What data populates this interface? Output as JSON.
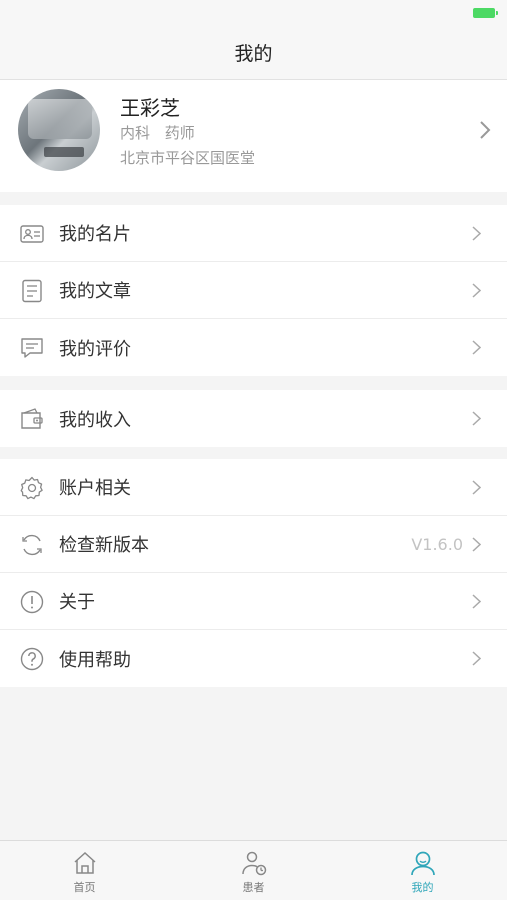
{
  "nav": {
    "title": "我的"
  },
  "profile": {
    "name": "王彩芝",
    "department": "内科",
    "role": "药师",
    "hospital": "北京市平谷区国医堂"
  },
  "groups": [
    {
      "items": [
        {
          "label": "我的名片",
          "icon": "id-card-icon"
        },
        {
          "label": "我的文章",
          "icon": "document-icon"
        },
        {
          "label": "我的评价",
          "icon": "comment-icon"
        }
      ]
    },
    {
      "items": [
        {
          "label": "我的收入",
          "icon": "wallet-icon"
        }
      ]
    },
    {
      "items": [
        {
          "label": "账户相关",
          "icon": "gear-icon"
        },
        {
          "label": "检查新版本",
          "icon": "refresh-icon",
          "value": "V1.6.0"
        },
        {
          "label": "关于",
          "icon": "info-icon"
        },
        {
          "label": "使用帮助",
          "icon": "help-icon"
        }
      ]
    }
  ],
  "tabs": [
    {
      "label": "首页",
      "icon": "home-icon"
    },
    {
      "label": "患者",
      "icon": "patient-icon"
    },
    {
      "label": "我的",
      "icon": "profile-icon",
      "active": true
    }
  ],
  "colors": {
    "accent": "#2fa6b9",
    "battery": "#4cd964"
  }
}
